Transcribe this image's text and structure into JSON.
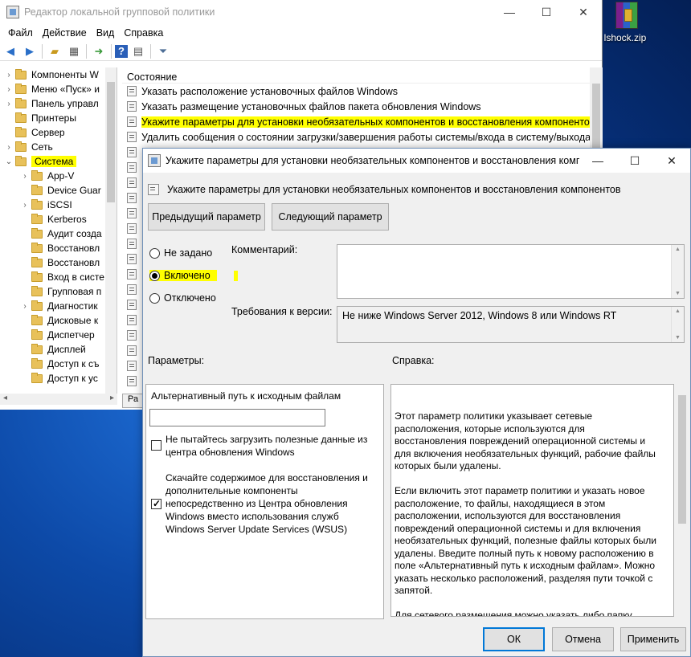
{
  "desktop": {
    "icon_label": "lshock.zip"
  },
  "main_window": {
    "title": "Редактор локальной групповой политики",
    "menu": [
      "Файл",
      "Действие",
      "Вид",
      "Справка"
    ],
    "tree": [
      {
        "label": "Компоненты W",
        "expander": "›",
        "level": 1
      },
      {
        "label": "Меню «Пуск» и",
        "expander": "›",
        "level": 1
      },
      {
        "label": "Панель управл",
        "expander": "›",
        "level": 1
      },
      {
        "label": "Принтеры",
        "expander": "",
        "level": 1
      },
      {
        "label": "Сервер",
        "expander": "",
        "level": 1
      },
      {
        "label": "Сеть",
        "expander": "›",
        "level": 1
      },
      {
        "label": "Система",
        "expander": "⌄",
        "level": 1,
        "selected": true
      },
      {
        "label": "App-V",
        "expander": "›",
        "level": 2
      },
      {
        "label": "Device Guar",
        "expander": "",
        "level": 2
      },
      {
        "label": "iSCSI",
        "expander": "›",
        "level": 2
      },
      {
        "label": "Kerberos",
        "expander": "",
        "level": 2
      },
      {
        "label": "Аудит созда",
        "expander": "",
        "level": 2
      },
      {
        "label": "Восстановл",
        "expander": "",
        "level": 2
      },
      {
        "label": "Восстановл",
        "expander": "",
        "level": 2
      },
      {
        "label": "Вход в систе",
        "expander": "",
        "level": 2
      },
      {
        "label": "Групповая п",
        "expander": "",
        "level": 2
      },
      {
        "label": "Диагностик",
        "expander": "›",
        "level": 2
      },
      {
        "label": "Дисковые к",
        "expander": "",
        "level": 2
      },
      {
        "label": "Диспетчер ",
        "expander": "",
        "level": 2
      },
      {
        "label": "Дисплей",
        "expander": "",
        "level": 2
      },
      {
        "label": "Доступ к съ",
        "expander": "",
        "level": 2
      },
      {
        "label": "Доступ к ус",
        "expander": "",
        "level": 2
      }
    ],
    "list_header": "Состояние",
    "list_items": [
      {
        "label": "Указать расположение установочных файлов Windows",
        "highlight": false
      },
      {
        "label": "Указать размещение установочных файлов пакета обновления Windows",
        "highlight": false
      },
      {
        "label": "Укажите параметры для установки необязательных компонентов и восстановления компонентов",
        "highlight": true
      },
      {
        "label": "Удалить сообщения о состоянии загрузки/завершения работы системы/входа в систему/выхода из с",
        "highlight": false
      },
      {
        "label": "",
        "highlight": false
      },
      {
        "label": "",
        "highlight": false
      },
      {
        "label": "",
        "highlight": false
      },
      {
        "label": "",
        "highlight": false
      },
      {
        "label": "",
        "highlight": false
      },
      {
        "label": "",
        "highlight": false
      },
      {
        "label": "",
        "highlight": false
      },
      {
        "label": "",
        "highlight": false
      },
      {
        "label": "",
        "highlight": false
      },
      {
        "label": "",
        "highlight": false
      },
      {
        "label": "",
        "highlight": false
      },
      {
        "label": "",
        "highlight": false
      },
      {
        "label": "",
        "highlight": false
      },
      {
        "label": "",
        "highlight": false
      },
      {
        "label": "",
        "highlight": false
      },
      {
        "label": "",
        "highlight": false
      }
    ],
    "bottom_tab": "Ра"
  },
  "dialog": {
    "title": "Укажите параметры для установки необязательных компонентов и восстановления компо...",
    "header": "Укажите параметры для установки необязательных компонентов и восстановления компонентов",
    "prev_button": "Предыдущий параметр",
    "next_button": "Следующий параметр",
    "radios": [
      {
        "label": "Не задано",
        "checked": false
      },
      {
        "label": "Включено",
        "checked": true
      },
      {
        "label": "Отключено",
        "checked": false
      }
    ],
    "comment_label": "Комментарий:",
    "comment_value": "",
    "supported_label": "Требования к версии:",
    "supported_value": "Не ниже Windows Server 2012, Windows 8 или Windows RT",
    "options_label": "Параметры:",
    "help_label": "Справка:",
    "alt_path_label": "Альтернативный путь к исходным файлам",
    "alt_path_value": "",
    "checkbox1": {
      "label": "Не пытайтесь загрузить полезные данные из центра обновления Windows",
      "checked": false
    },
    "checkbox2": {
      "label_pre": "Скачайте содержимое для восстановления и дополнительные компоненты",
      "label": "непосредственно из Центра обновления Windows вместо использования служб Windows Server Update Services (WSUS)",
      "checked": true
    },
    "help_text": "Этот параметр политики указывает сетевые расположения, которые используются для восстановления повреждений операционной системы и для включения необязательных функций, рабочие файлы которых были удалены.\n\nЕсли включить этот параметр политики и указать новое расположение, то файлы, находящиеся в этом расположении, используются для восстановления повреждений операционной системы и для включения необязательных функций, полезные файлы которых были удалены. Введите полный путь к новому расположению в поле «Альтернативный путь к исходным файлам». Можно указать несколько расположений, разделяя пути точкой с запятой.\n\nДля сетевого размещения можно указать либо папку, либо WIM-файл. Если выбран WIM-файл, путь расположения",
    "ok_button": "ОК",
    "cancel_button": "Отмена",
    "apply_button": "Применить"
  },
  "colors": {
    "highlight": "#ffff00",
    "accent": "#0078d7"
  }
}
